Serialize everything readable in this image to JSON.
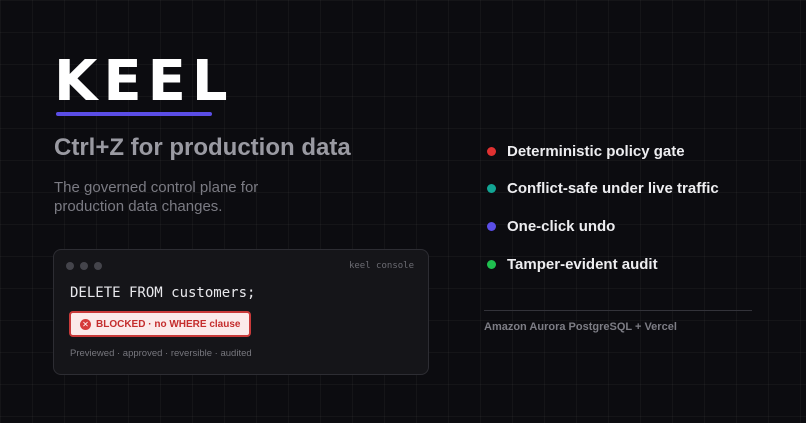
{
  "brand": {
    "logo": "KEEL",
    "accent": "#5b4ee6",
    "tagline": "Ctrl+Z for production data",
    "description": "The governed control plane for production data changes."
  },
  "console": {
    "title": "keel console",
    "window_dots": 3,
    "sql": "DELETE FROM customers;",
    "status_badge": "BLOCKED · no WHERE clause",
    "status_icon": "x-circle-icon",
    "status_color": "#c93a3a",
    "footer": "Previewed · approved · reversible · audited"
  },
  "features": [
    {
      "label": "Deterministic policy gate",
      "color": "#e03131"
    },
    {
      "label": "Conflict-safe under live traffic",
      "color": "#12a594"
    },
    {
      "label": "One-click undo",
      "color": "#5b4ee6"
    },
    {
      "label": "Tamper-evident audit",
      "color": "#1fbf4f"
    }
  ],
  "platform": "Amazon Aurora PostgreSQL + Vercel"
}
